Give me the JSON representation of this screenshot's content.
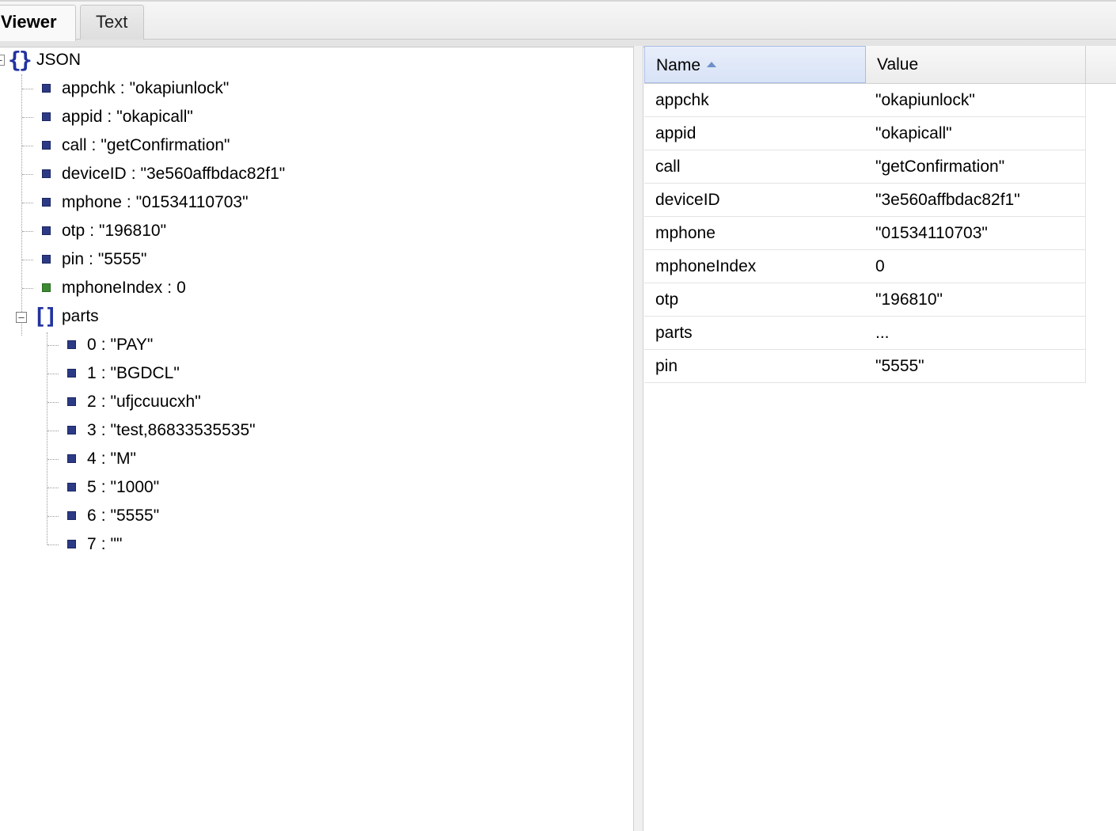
{
  "tabs": [
    {
      "label": "Viewer",
      "active": true
    },
    {
      "label": "Text",
      "active": false
    }
  ],
  "tree": {
    "root_label": "JSON",
    "root_icon": "object-braces-icon",
    "items": [
      {
        "key": "appchk",
        "value": "\"okapiunlock\"",
        "kind": "string"
      },
      {
        "key": "appid",
        "value": "\"okapicall\"",
        "kind": "string"
      },
      {
        "key": "call",
        "value": "\"getConfirmation\"",
        "kind": "string"
      },
      {
        "key": "deviceID",
        "value": "\"3e560affbdac82f1\"",
        "kind": "string"
      },
      {
        "key": "mphone",
        "value": "\"01534110703\"",
        "kind": "string"
      },
      {
        "key": "otp",
        "value": "\"196810\"",
        "kind": "string"
      },
      {
        "key": "pin",
        "value": "\"5555\"",
        "kind": "string"
      },
      {
        "key": "mphoneIndex",
        "value": "0",
        "kind": "number"
      }
    ],
    "array": {
      "label": "parts",
      "icon": "array-brackets-icon",
      "items": [
        {
          "key": "0",
          "value": "\"PAY\""
        },
        {
          "key": "1",
          "value": "\"BGDCL\""
        },
        {
          "key": "2",
          "value": "\"ufjccuucxh\""
        },
        {
          "key": "3",
          "value": "\"test,86833535535\""
        },
        {
          "key": "4",
          "value": "\"M\""
        },
        {
          "key": "5",
          "value": "\"1000\""
        },
        {
          "key": "6",
          "value": "\"5555\""
        },
        {
          "key": "7",
          "value": "\"\""
        }
      ]
    },
    "separator": ":"
  },
  "grid": {
    "columns": {
      "name": "Name",
      "value": "Value"
    },
    "sort": "name-ascending",
    "rows": [
      {
        "name": "appchk",
        "value": "\"okapiunlock\""
      },
      {
        "name": "appid",
        "value": "\"okapicall\""
      },
      {
        "name": "call",
        "value": "\"getConfirmation\""
      },
      {
        "name": "deviceID",
        "value": "\"3e560affbdac82f1\""
      },
      {
        "name": "mphone",
        "value": "\"01534110703\""
      },
      {
        "name": "mphoneIndex",
        "value": "0"
      },
      {
        "name": "otp",
        "value": "\"196810\""
      },
      {
        "name": "parts",
        "value": "..."
      },
      {
        "name": "pin",
        "value": "\"5555\""
      }
    ]
  },
  "colors": {
    "string_marker": "#2c3a86",
    "number_marker": "#3b8a32",
    "brace": "#2233a0",
    "header_selected": "#d8e3f7"
  }
}
